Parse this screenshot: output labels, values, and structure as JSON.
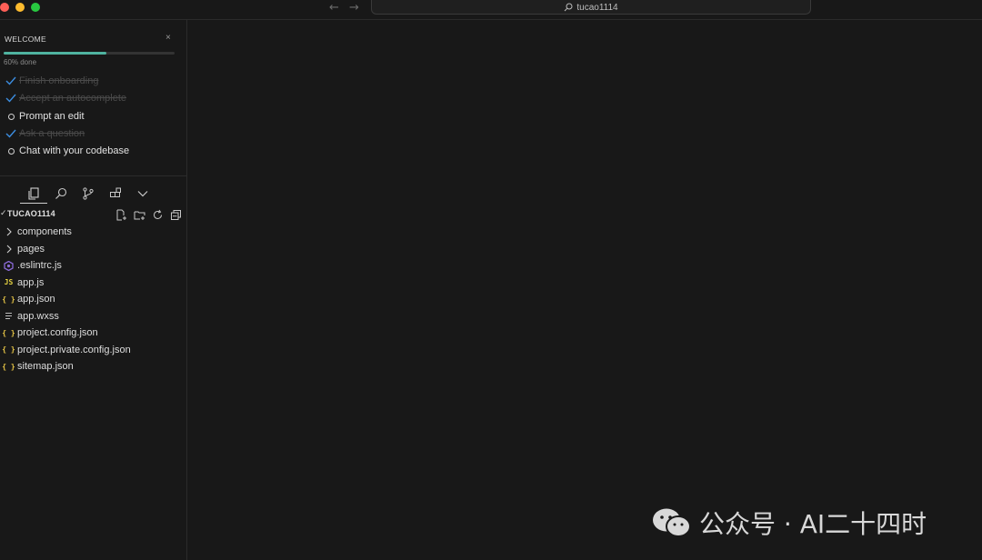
{
  "titlebar": {
    "search_text": "tucao1114"
  },
  "welcome": {
    "title": "WELCOME",
    "close_glyph": "×",
    "progress_percent": 60,
    "progress_text": "60% done",
    "tasks": [
      {
        "label": "Finish onboarding",
        "done": true
      },
      {
        "label": "Accept an autocomplete",
        "done": true
      },
      {
        "label": "Prompt an edit",
        "done": false
      },
      {
        "label": "Ask a question",
        "done": true
      },
      {
        "label": "Chat with your codebase",
        "done": false
      }
    ]
  },
  "explorer": {
    "title": "TUCAO1114",
    "items": [
      {
        "name": "components",
        "type": "folder",
        "icon": "chevron-right-icon"
      },
      {
        "name": "pages",
        "type": "folder",
        "icon": "chevron-right-icon"
      },
      {
        "name": ".eslintrc.js",
        "type": "file",
        "icon": "eslint-icon"
      },
      {
        "name": "app.js",
        "type": "file",
        "icon": "js-icon",
        "badge": "JS"
      },
      {
        "name": "app.json",
        "type": "file",
        "icon": "json-icon",
        "badge": "{ }"
      },
      {
        "name": "app.wxss",
        "type": "file",
        "icon": "lines-icon"
      },
      {
        "name": "project.config.json",
        "type": "file",
        "icon": "json-icon",
        "badge": "{ }"
      },
      {
        "name": "project.private.config.json",
        "type": "file",
        "icon": "json-icon",
        "badge": "{ }"
      },
      {
        "name": "sitemap.json",
        "type": "file",
        "icon": "json-icon",
        "badge": "{ }"
      }
    ]
  },
  "watermark": {
    "text": "公众号 · AI二十四时"
  },
  "colors": {
    "background": "#181818",
    "progress": "#4fb3a0",
    "check": "#3c8de0",
    "js_badge": "#e6d341",
    "json_badge": "#e8c646",
    "eslint": "#8a6ad6"
  }
}
